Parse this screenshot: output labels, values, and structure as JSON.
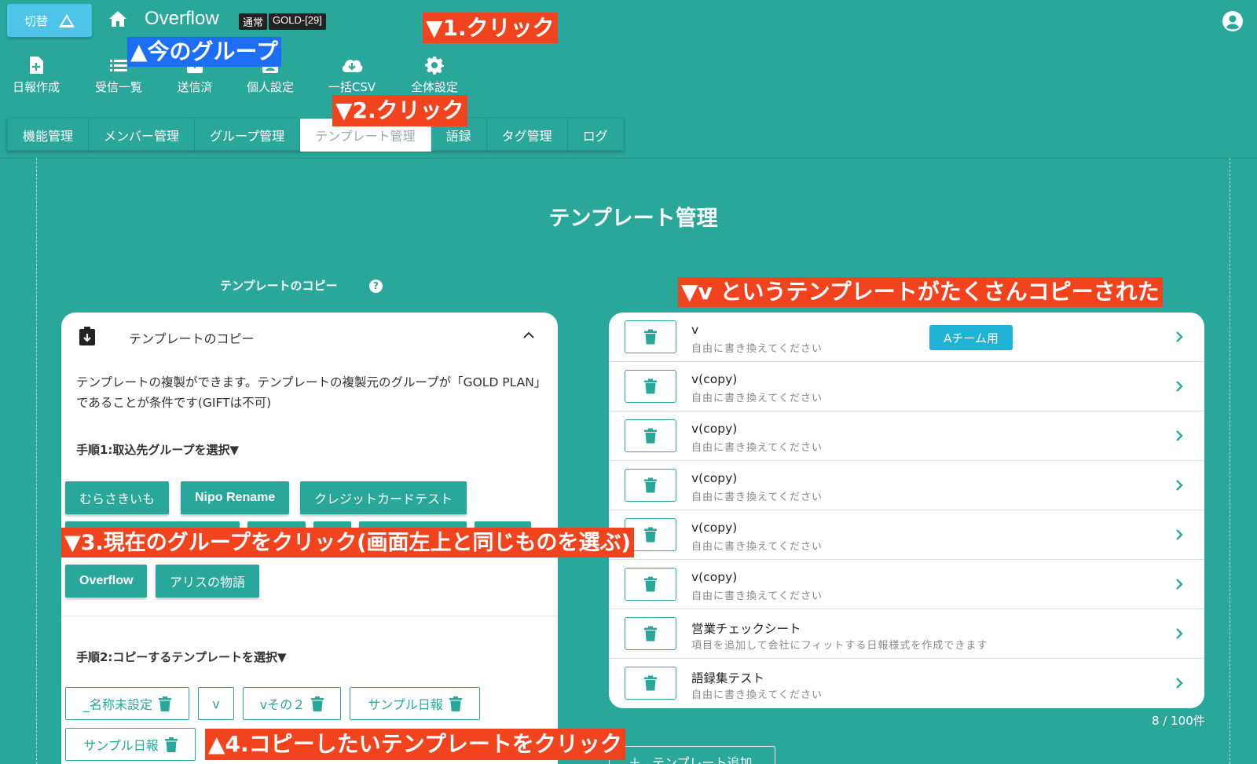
{
  "header": {
    "switch_label": "切替",
    "app_title": "Overflow",
    "badges": [
      "通常",
      "GOLD-[29]"
    ]
  },
  "nav": [
    {
      "label": "日報作成",
      "icon": "file-plus-icon"
    },
    {
      "label": "受信一覧",
      "icon": "list-icon"
    },
    {
      "label": "送信済",
      "icon": "outbox-icon"
    },
    {
      "label": "個人設定",
      "icon": "person-badge-icon"
    },
    {
      "label": "一括CSV",
      "icon": "cloud-download-icon"
    },
    {
      "label": "全体設定",
      "icon": "gear-icon"
    }
  ],
  "tabs": [
    "機能管理",
    "メンバー管理",
    "グループ管理",
    "テンプレート管理",
    "語録",
    "タグ管理",
    "ログ"
  ],
  "page_title": "テンプレート管理",
  "copy_section": {
    "label": "テンプレートのコピー",
    "help": "?",
    "card_title": "テンプレートのコピー",
    "description": "テンプレートの複製ができます。テンプレートの複製元のグループが「GOLD PLAN」であることが条件です(GIFTは不可)",
    "step1": "手順1:取込先グループを選択▼",
    "groups_row1": [
      "むらさきいも",
      "Nipo Rename",
      "クレジットカードテスト"
    ],
    "groups_row3": [
      "Overflow",
      "アリスの物語"
    ],
    "step2": "手順2:コピーするテンプレートを選択▼",
    "templates": [
      {
        "label": "_名称未設定",
        "trash": true
      },
      {
        "label": "v",
        "trash": false
      },
      {
        "label": "vその２",
        "trash": true
      },
      {
        "label": "サンプル日報",
        "trash": true
      },
      {
        "label": "サンプル日報",
        "trash": true
      }
    ]
  },
  "template_list": {
    "rows": [
      {
        "name": "v",
        "desc": "自由に書き換えてください",
        "tag": "Aチーム用"
      },
      {
        "name": "v(copy)",
        "desc": "自由に書き換えてください",
        "tag": ""
      },
      {
        "name": "v(copy)",
        "desc": "自由に書き換えてください",
        "tag": ""
      },
      {
        "name": "v(copy)",
        "desc": "自由に書き換えてください",
        "tag": ""
      },
      {
        "name": "v(copy)",
        "desc": "自由に書き換えてください",
        "tag": ""
      },
      {
        "name": "v(copy)",
        "desc": "自由に書き換えてください",
        "tag": ""
      },
      {
        "name": "営業チェックシート",
        "desc": "項目を追加して会社にフィットする日報様式を作成できます",
        "tag": ""
      },
      {
        "name": "語録集テスト",
        "desc": "自由に書き換えてください",
        "tag": ""
      }
    ],
    "count": "8 / 100件",
    "add_label": "テンプレート追加"
  },
  "annotations": {
    "current_group": "▲今のグループ",
    "step1_click": "▼1.クリック",
    "step2_click": "▼2.クリック",
    "step3": "▼3.現在のグループをクリック(画面左上と同じものを選ぶ)",
    "step4": "▲4.コピーしたいテンプレートをクリック",
    "copied_note": "▼v というテンプレートがたくさんコピーされた"
  },
  "colors": {
    "background": "#2aa79b",
    "accent": "#2aa79b",
    "switch": "#4fc3e8",
    "tag": "#1fb3d6",
    "annotation_red": "#f1431d",
    "annotation_blue": "#1e6df5"
  }
}
